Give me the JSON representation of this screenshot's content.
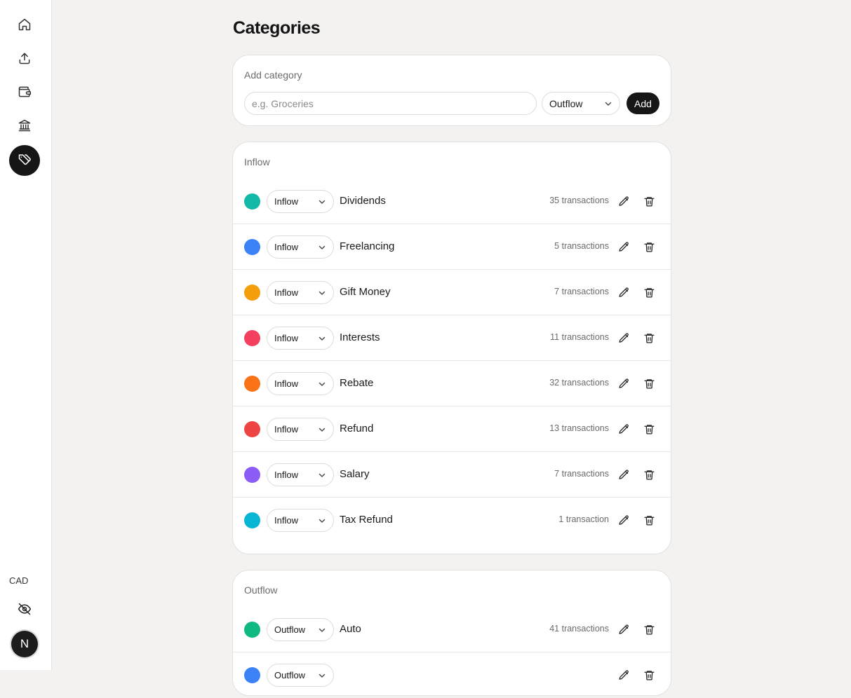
{
  "sidebar": {
    "nav": [
      {
        "icon": "home-icon",
        "active": false
      },
      {
        "icon": "upload-icon",
        "active": false
      },
      {
        "icon": "wallet-icon",
        "active": false
      },
      {
        "icon": "bank-icon",
        "active": false
      },
      {
        "icon": "tags-icon",
        "active": true
      }
    ],
    "currency": "CAD",
    "avatar_initial": "N"
  },
  "page": {
    "title": "Categories"
  },
  "add_category": {
    "label": "Add category",
    "placeholder": "e.g. Groceries",
    "type_value": "Outflow",
    "add_label": "Add"
  },
  "inflow": {
    "title": "Inflow",
    "items": [
      {
        "color": "#14b8a6",
        "type": "Inflow",
        "name": "Dividends",
        "count": "35 transactions"
      },
      {
        "color": "#3b82f6",
        "type": "Inflow",
        "name": "Freelancing",
        "count": "5 transactions"
      },
      {
        "color": "#f59e0b",
        "type": "Inflow",
        "name": "Gift Money",
        "count": "7 transactions"
      },
      {
        "color": "#f43f5e",
        "type": "Inflow",
        "name": "Interests",
        "count": "11 transactions"
      },
      {
        "color": "#f97316",
        "type": "Inflow",
        "name": "Rebate",
        "count": "32 transactions"
      },
      {
        "color": "#ef4444",
        "type": "Inflow",
        "name": "Refund",
        "count": "13 transactions"
      },
      {
        "color": "#8b5cf6",
        "type": "Inflow",
        "name": "Salary",
        "count": "7 transactions"
      },
      {
        "color": "#06b6d4",
        "type": "Inflow",
        "name": "Tax Refund",
        "count": "1 transaction"
      }
    ]
  },
  "outflow": {
    "title": "Outflow",
    "items": [
      {
        "color": "#10b981",
        "type": "Outflow",
        "name": "Auto",
        "count": "41 transactions"
      },
      {
        "color": "#3b82f6",
        "type": "Outflow",
        "name": "",
        "count": ""
      }
    ]
  }
}
